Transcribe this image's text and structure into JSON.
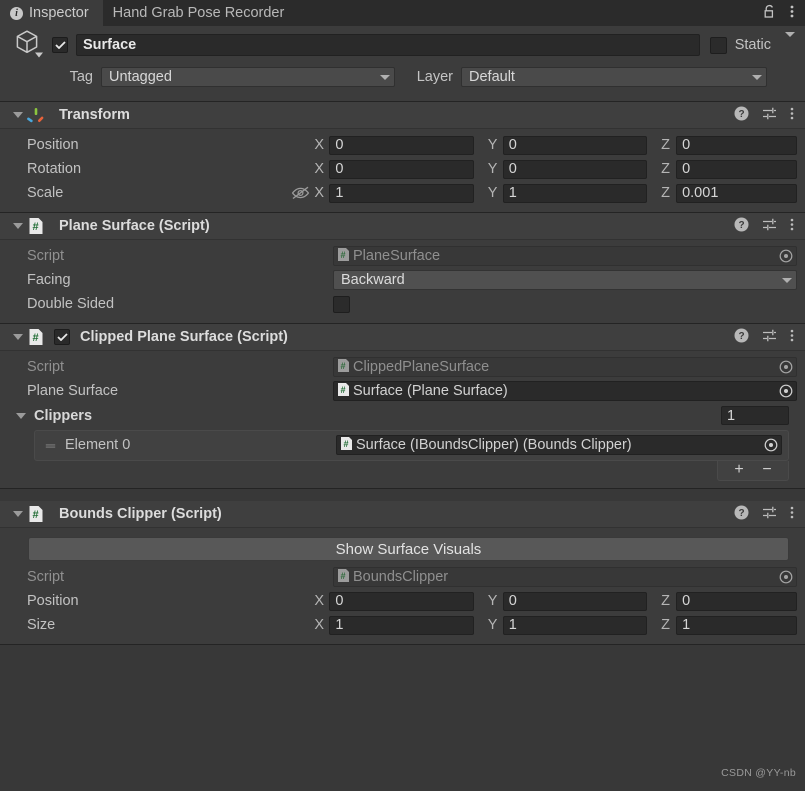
{
  "window": {
    "tabs": [
      {
        "label": "Inspector",
        "icon": "info-icon",
        "active": true
      },
      {
        "label": "Hand Grab Pose Recorder",
        "icon": "",
        "active": false
      }
    ],
    "lock_icon": "lock-open-icon",
    "menu_icon": "kebab-menu-icon"
  },
  "object_header": {
    "icon": "cube-gameobject-icon",
    "enabled_checkbox": true,
    "name": "Surface",
    "static_checkbox": false,
    "static_label": "Static",
    "tag_label": "Tag",
    "tag_value": "Untagged",
    "layer_label": "Layer",
    "layer_value": "Default"
  },
  "components": [
    {
      "id": "transform",
      "title": "Transform",
      "icon": "transform-gizmo-icon",
      "expanded": true,
      "has_enable_checkbox": false,
      "help_icon": "help-icon",
      "preset_icon": "preset-slider-icon",
      "menu_icon": "kebab-menu-icon",
      "vector_rows": [
        {
          "label": "Position",
          "x": "0",
          "y": "0",
          "z": "0",
          "has_eye_off": false
        },
        {
          "label": "Rotation",
          "x": "0",
          "y": "0",
          "z": "0",
          "has_eye_off": false
        },
        {
          "label": "Scale",
          "x": "1",
          "y": "1",
          "z": "0.001",
          "has_eye_off": true,
          "eye_icon": "eye-off-icon"
        }
      ]
    },
    {
      "id": "plane-surface",
      "title": "Plane Surface (Script)",
      "icon": "cs-script-icon",
      "expanded": true,
      "has_enable_checkbox": false,
      "help_icon": "help-icon",
      "preset_icon": "preset-slider-icon",
      "menu_icon": "kebab-menu-icon",
      "rows": [
        {
          "type": "object",
          "label": "Script",
          "value": "PlaneSurface",
          "readonly": true,
          "icon": "cs-script-icon",
          "select_icon": "object-picker-icon"
        },
        {
          "type": "dropdown",
          "label": "Facing",
          "value": "Backward"
        },
        {
          "type": "checkbox",
          "label": "Double Sided",
          "checked": false
        }
      ]
    },
    {
      "id": "clipped-plane-surface",
      "title": "Clipped Plane Surface (Script)",
      "icon": "cs-script-icon",
      "expanded": true,
      "has_enable_checkbox": true,
      "enabled": true,
      "help_icon": "help-icon",
      "preset_icon": "preset-slider-icon",
      "menu_icon": "kebab-menu-icon",
      "rows": [
        {
          "type": "object",
          "label": "Script",
          "value": "ClippedPlaneSurface",
          "readonly": true,
          "icon": "cs-script-icon",
          "select_icon": "object-picker-icon"
        },
        {
          "type": "object",
          "label": "Plane Surface",
          "value": "Surface (Plane Surface)",
          "readonly": false,
          "icon": "cs-script-icon",
          "select_icon": "object-picker-icon"
        }
      ],
      "array": {
        "label": "Clippers",
        "size": "1",
        "expanded": true,
        "elements": [
          {
            "label": "Element 0",
            "value": "Surface (IBoundsClipper) (Bounds Clipper)",
            "icon": "cs-script-icon",
            "select_icon": "object-picker-icon",
            "drag_icon": "drag-handle-icon"
          }
        ],
        "add_label": "+",
        "remove_label": "−"
      }
    },
    {
      "id": "bounds-clipper",
      "title": "Bounds Clipper (Script)",
      "icon": "cs-script-icon",
      "expanded": true,
      "has_enable_checkbox": false,
      "help_icon": "help-icon",
      "preset_icon": "preset-slider-icon",
      "menu_icon": "kebab-menu-icon",
      "button_label": "Show Surface Visuals",
      "rows": [
        {
          "type": "object",
          "label": "Script",
          "value": "BoundsClipper",
          "readonly": true,
          "icon": "cs-script-icon",
          "select_icon": "object-picker-icon"
        }
      ],
      "vector_rows": [
        {
          "label": "Position",
          "x": "0",
          "y": "0",
          "z": "0",
          "has_eye_off": false
        },
        {
          "label": "Size",
          "x": "1",
          "y": "1",
          "z": "1",
          "has_eye_off": false
        }
      ]
    }
  ],
  "axis_labels": {
    "x": "X",
    "y": "Y",
    "z": "Z"
  },
  "watermark": "CSDN @YY-nb",
  "colors": {
    "background": "#383838",
    "panel": "#3c3c3c",
    "tab_active": "#3c3c3c",
    "tab_inactive": "#2b2b2b",
    "field": "#2a2a2a",
    "dropdown": "#505050",
    "button": "#585858",
    "text": "#c4c4c4",
    "axis_green": "#8cc63f",
    "axis_blue": "#4aa8dd",
    "axis_orange": "#e8623a"
  }
}
